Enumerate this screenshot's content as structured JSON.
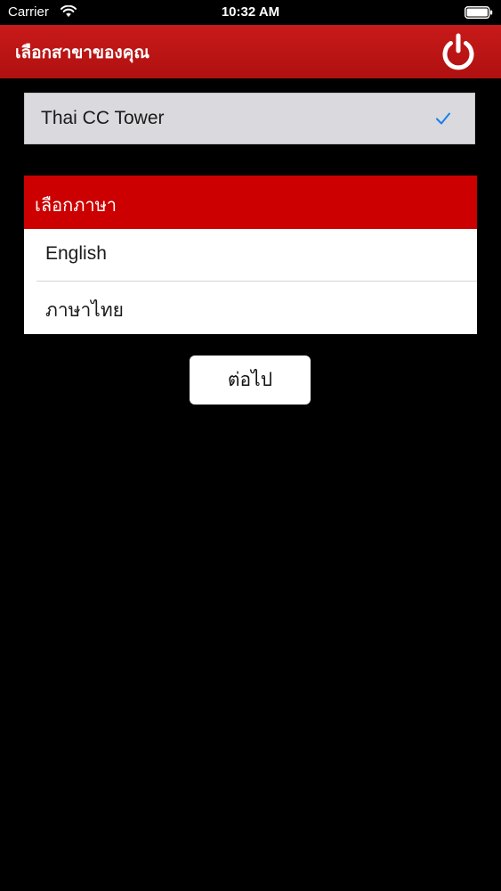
{
  "status_bar": {
    "carrier": "Carrier",
    "time": "10:32 AM"
  },
  "nav": {
    "title": "เลือกสาขาของคุณ",
    "power_icon": "power-icon"
  },
  "branch": {
    "name": "Thai CC Tower",
    "selected": true
  },
  "language_section": {
    "header": "เลือกภาษา",
    "options": [
      {
        "label": "English"
      },
      {
        "label": "ภาษาไทย"
      }
    ]
  },
  "next_button": {
    "label": "ต่อไป"
  },
  "colors": {
    "nav_red": "#b81414",
    "header_red": "#cc0000",
    "check_blue": "#1a7fe8",
    "background": "#000000"
  }
}
